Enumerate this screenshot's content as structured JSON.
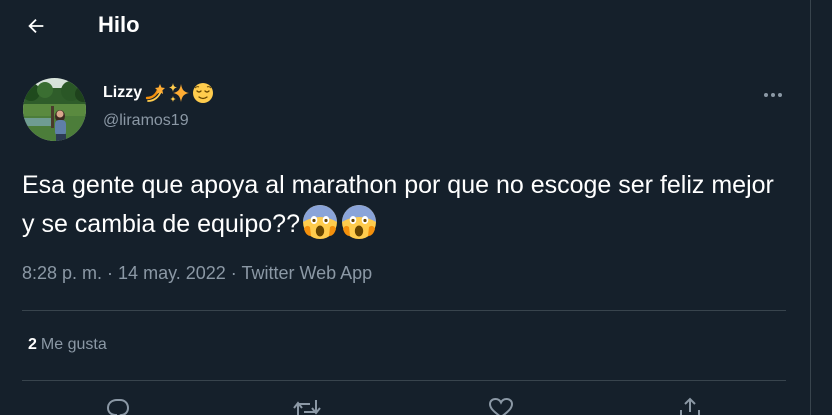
{
  "header": {
    "back_icon": "arrow-left-icon",
    "title": "Hilo"
  },
  "tweet": {
    "author": {
      "name": "Lizzy",
      "name_emojis": [
        "dizzy-emoji",
        "sparkles-emoji",
        "relieved-face-emoji"
      ],
      "handle": "@liramos19"
    },
    "more_icon": "more-horizontal-icon",
    "text": "Esa gente que apoya al marathon por que no escoge ser feliz mejor y se cambia de equipo??",
    "text_emojis": [
      "face-screaming-in-fear-emoji",
      "face-screaming-in-fear-emoji"
    ],
    "time": "8:28 p. m.",
    "separator": " · ",
    "date": "14 may. 2022",
    "source": "Twitter Web App",
    "likes": {
      "count": "2",
      "label": "Me gusta"
    },
    "actions": [
      "reply-icon",
      "retweet-icon",
      "like-icon",
      "share-icon"
    ]
  },
  "colors": {
    "background": "#15202b",
    "border": "#38444d",
    "text_primary": "#ffffff",
    "text_secondary": "#8b98a5"
  }
}
